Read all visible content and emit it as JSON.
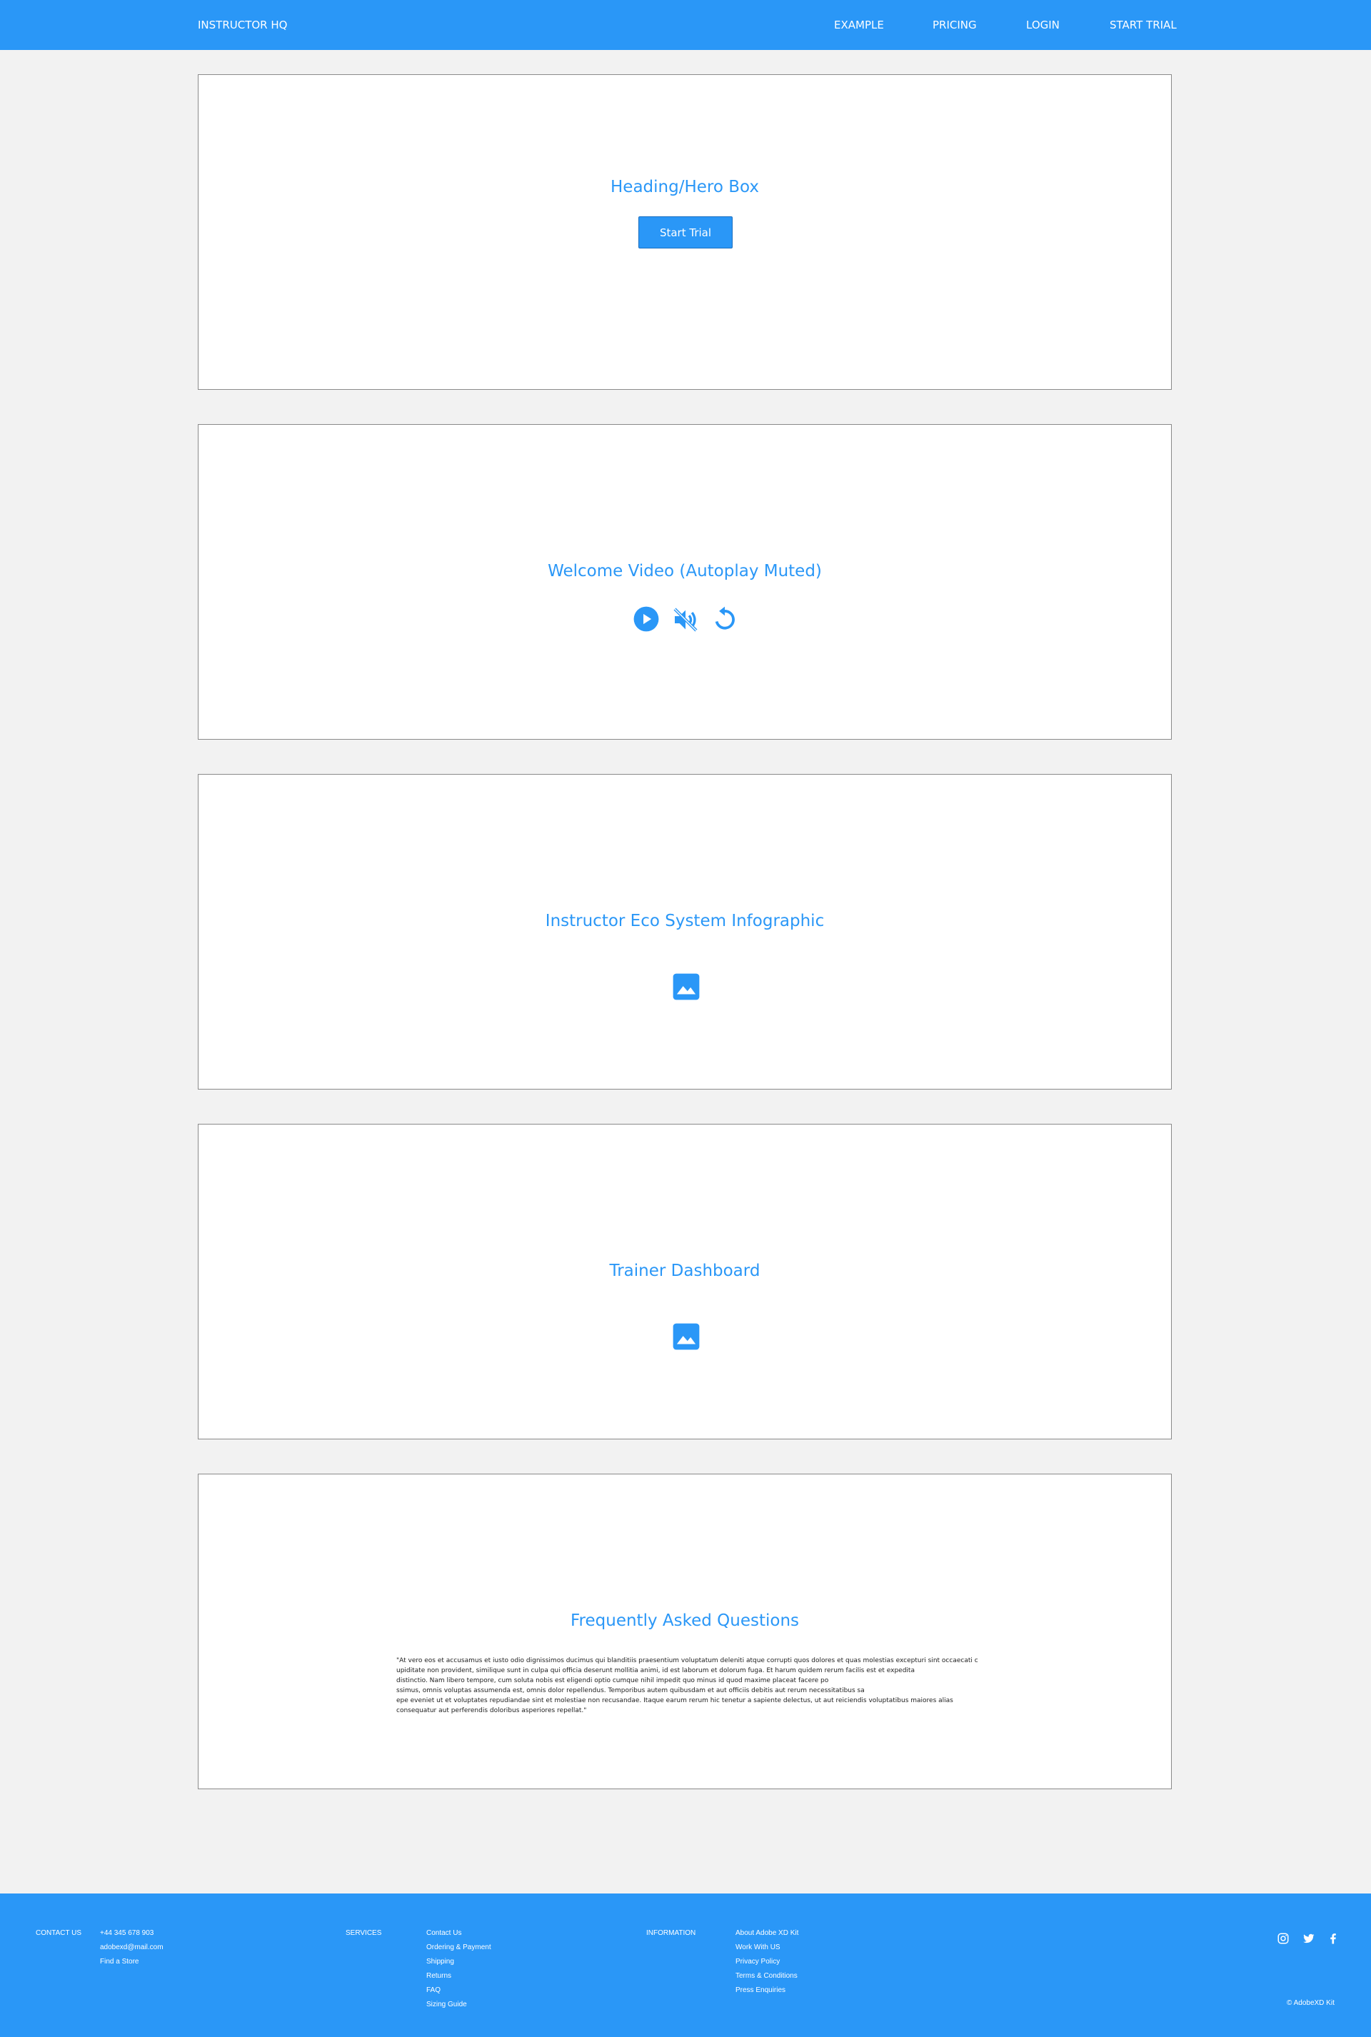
{
  "nav": {
    "brand": "INSTRUCTOR HQ",
    "links": [
      "EXAMPLE",
      "PRICING",
      "LOGIN",
      "START TRIAL"
    ]
  },
  "hero": {
    "title": "Heading/Hero Box",
    "button_label": "Start Trial"
  },
  "video": {
    "title": "Welcome Video (Autoplay Muted)",
    "icons": [
      "play-icon",
      "mute-icon",
      "replay-icon"
    ]
  },
  "infographic": {
    "title": "Instructor Eco System Infographic",
    "icon": "image-icon"
  },
  "dashboard": {
    "title": "Trainer Dashboard",
    "icon": "image-icon"
  },
  "faq": {
    "title": "Frequently Asked Questions",
    "body": "\"At vero eos et accusamus et iusto odio dignissimos ducimus qui blanditiis praesentium voluptatum deleniti atque corrupti quos dolores et quas molestias excepturi sint occaecati c\nupiditate non provident, similique sunt in culpa qui officia deserunt mollitia animi, id est laborum et dolorum fuga. Et harum quidem rerum facilis est et expedita\n distinctio. Nam libero tempore, cum soluta nobis est eligendi optio cumque nihil impedit quo minus id quod maxime placeat facere po\nssimus, omnis voluptas assumenda est, omnis dolor repellendus. Temporibus autem quibusdam et aut officiis debitis aut rerum necessitatibus sa\nepe eveniet ut et voluptates repudiandae sint et molestiae non recusandae. Itaque earum rerum hic tenetur a sapiente delectus, ut aut reiciendis voluptatibus maiores alias\nconsequatur aut perferendis doloribus asperiores repellat.\""
  },
  "footer": {
    "contact": {
      "heading": "CONTACT US",
      "items": [
        "+44 345 678 903",
        "adobexd@mail.com",
        "Find a Store"
      ]
    },
    "services": {
      "heading": "SERVICES",
      "items": [
        "Contact Us",
        "Ordering & Payment",
        "Shipping",
        "Returns",
        "FAQ",
        "Sizing Guide"
      ]
    },
    "information": {
      "heading": "INFORMATION",
      "items": [
        "About Adobe XD Kit",
        "Work With US",
        "Privacy Policy",
        "Terms & Conditions",
        "Press Enquiries"
      ]
    },
    "social": [
      "instagram-icon",
      "twitter-icon",
      "facebook-icon"
    ],
    "copyright": "© AdobeXD Kit"
  },
  "colors": {
    "accent": "#2a97f7",
    "background": "#f2f2f2",
    "box": "#ffffff",
    "border": "#8a8a8a"
  }
}
